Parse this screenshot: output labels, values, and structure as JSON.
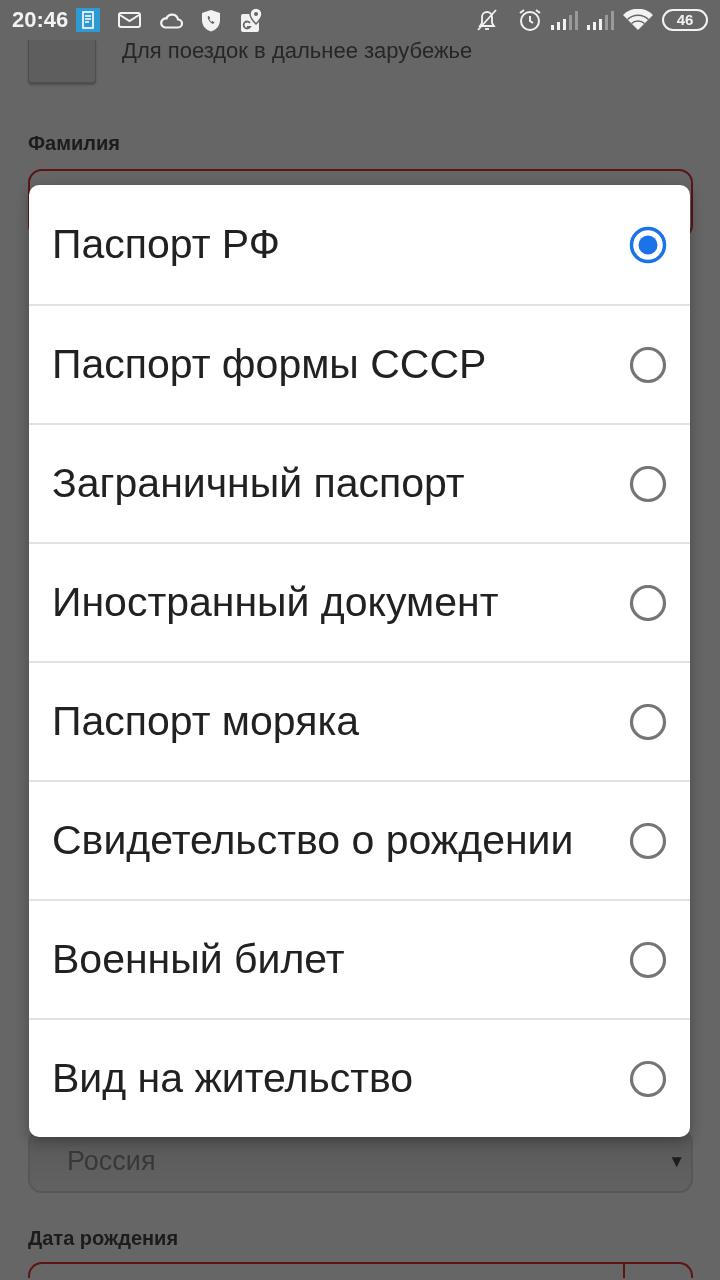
{
  "status_bar": {
    "time": "20:46",
    "battery": "46"
  },
  "background_form": {
    "foreign_travel_checkbox": {
      "label": "Для поездок в дальнее зарубежье",
      "checked": false
    },
    "surname": {
      "label": "Фамилия"
    },
    "country_select": {
      "value": "Россия",
      "arrow": "▼"
    },
    "birth_date": {
      "label": "Дата рождения"
    }
  },
  "document_type_dialog": {
    "options": [
      {
        "label": "Паспорт РФ",
        "selected": true
      },
      {
        "label": "Паспорт формы СССР",
        "selected": false
      },
      {
        "label": "Заграничный паспорт",
        "selected": false
      },
      {
        "label": "Иностранный документ",
        "selected": false
      },
      {
        "label": "Паспорт моряка",
        "selected": false
      },
      {
        "label": "Свидетельство о рождении",
        "selected": false
      },
      {
        "label": "Военный билет",
        "selected": false
      },
      {
        "label": "Вид на жительство",
        "selected": false
      }
    ]
  }
}
